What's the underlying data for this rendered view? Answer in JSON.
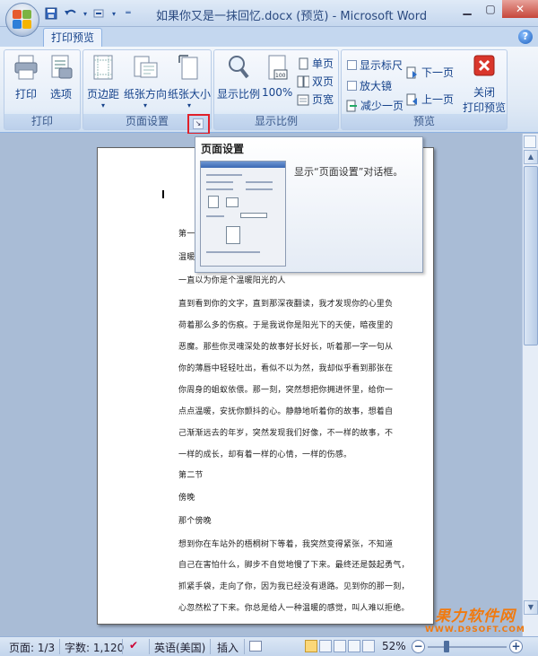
{
  "window": {
    "title": "如果你又是一抹回忆.docx (预览) - Microsoft Word"
  },
  "quick_access": [
    "save-icon",
    "undo-icon",
    "redo-icon",
    "customize-icon"
  ],
  "tabs": [
    {
      "label": "打印预览",
      "active": true
    }
  ],
  "ribbon": {
    "print_group": {
      "label": "打印",
      "print": "打印",
      "options": "选项"
    },
    "page_setup_group": {
      "label": "页面设置",
      "margins": "页边距",
      "orientation": "纸张方向",
      "size": "纸张大小"
    },
    "zoom_group": {
      "label": "显示比例",
      "zoom": "显示比例",
      "percent100": "100%",
      "one_page": "单页",
      "two_pages": "双页",
      "page_width": "页宽"
    },
    "preview_group": {
      "label": "预览",
      "show_ruler": "显示标尺",
      "magnifier": "放大镜",
      "shrink_one_page": "减少一页",
      "next_page": "下一页",
      "prev_page": "上一页",
      "close_line1": "关闭",
      "close_line2": "打印预览"
    }
  },
  "tooltip": {
    "title": "页面设置",
    "description": "显示“页面设置”对话框。"
  },
  "document": {
    "lines": [
      "第一节",
      "温暖",
      "一直以为你是个温暖阳光的人",
      "直到看到你的文字，直到那深夜翻读，我才发现你的心里负",
      "荷着那么多的伤痕。于是我说你是阳光下的天使，暗夜里的",
      "恶魔。那些你灵魂深处的故事好长好长，听着那一字一句从",
      "你的薄唇中轻轻吐出，看似不以为然，我却似乎看到那张在",
      "你周身的蛆蚁依偎。那一刻，突然想把你拥进怀里，给你一",
      "点点温暖，安抚你颤抖的心。静静地听着你的故事，想着自",
      "己渐渐远去的年岁，突然发现我们好像，不一样的故事，不",
      "一样的成长，却有着一样的心情，一样的伤感。",
      "第二节",
      "傍晚",
      "那个傍晚",
      "想到你在车站外的梧桐树下等着，我突然变得紧张，不知道",
      "自己在害怕什么，脚步不自觉地慢了下来。最终还是鼓起勇气，",
      "抓紧手袋，走向了你，因为我已经没有退路。见到你的那一刻，",
      "心忽然松了下来。你总是给人一种温暖的感觉，叫人难以拒绝。"
    ]
  },
  "statusbar": {
    "page": "页面: 1/3",
    "words": "字数: 1,120",
    "language": "英语(美国)",
    "insert": "插入",
    "zoom": "52%",
    "zoom_value_percent": 52
  },
  "watermark": {
    "line1": "果力软件网",
    "line2": "WWW.D9SOFT.COM"
  },
  "colors": {
    "accent": "#15428b",
    "launcher_highlight": "#e0202a",
    "watermark": "#f07a10",
    "close_red": "#d9362b"
  }
}
